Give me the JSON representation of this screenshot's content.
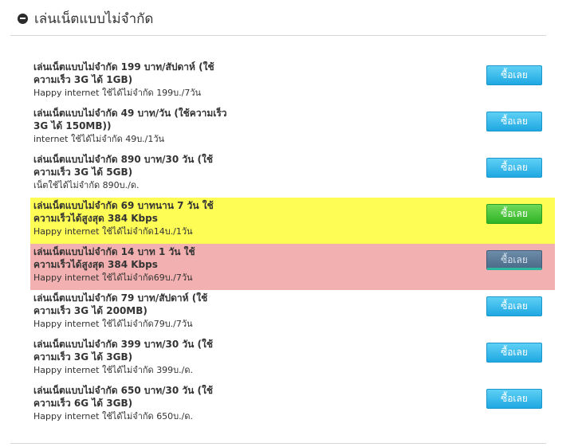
{
  "section": {
    "title": "เล่นเน็ตแบบไม่จำกัด"
  },
  "plans": [
    {
      "title_line1": "เล่นเน็ตแบบไม่จำกัด 199 บาท/สัปดาห์ (ใช้",
      "title_line2": "ความเร็ว 3G ได้ 1GB)",
      "description": "Happy internet ใช้ได้ไม่จำกัด 199บ./7วัน",
      "button_label": "ซื้อเลย",
      "highlight": "none"
    },
    {
      "title_line1": "เล่นเน็ตแบบไม่จำกัด 49 บาท/วัน (ใช้ความเร็ว",
      "title_line2": "3G ได้ 150MB))",
      "description": "internet ใช้ได้ไม่จำกัด 49บ./1วัน",
      "button_label": "ซื้อเลย",
      "highlight": "none"
    },
    {
      "title_line1": "เล่นเน็ตแบบไม่จำกัด 890 บาท/30 วัน (ใช้",
      "title_line2": "ความเร็ว 3G ได้ 5GB)",
      "description": "เน็ตใช้ได้ไม่จำกัด 890บ./ด.",
      "button_label": "ซื้อเลย",
      "highlight": "none"
    },
    {
      "title_line1": "เล่นเน็ตแบบไม่จำกัด 69 บาทนาน 7 วัน ใช้",
      "title_line2": "ความเร็วได้สูงสุด 384 Kbps",
      "description": "Happy internet ใช้ได้ไม่จำกัด14บ./1วัน",
      "button_label": "ซื้อเลย",
      "highlight": "yellow"
    },
    {
      "title_line1": "เล่นเน็ตแบบไม่จำกัด 14 บาท 1 วัน  ใช้",
      "title_line2": "ความเร็วได้สูงสุด 384 Kbps",
      "description": "Happy internet ใช้ได้ไม่จำกัด69บ./7วัน",
      "button_label": "ซื้อเลย",
      "highlight": "pink"
    },
    {
      "title_line1": "เล่นเน็ตแบบไม่จำกัด 79 บาท/สัปดาห์ (ใช้",
      "title_line2": "ความเร็ว 3G ได้ 200MB)",
      "description": "Happy internet ใช้ได้ไม่จำกัด79บ./7วัน",
      "button_label": "ซื้อเลย",
      "highlight": "none"
    },
    {
      "title_line1": "เล่นเน็ตแบบไม่จำกัด 399 บาท/30 วัน (ใช้",
      "title_line2": "ความเร็ว 3G ได้ 3GB)",
      "description": "Happy internet ใช้ได้ไม่จำกัด 399บ./ด.",
      "button_label": "ซื้อเลย",
      "highlight": "none"
    },
    {
      "title_line1": "เล่นเน็ตแบบไม่จำกัด 650 บาท/30 วัน (ใช้",
      "title_line2": "ความเร็ว 6G ได้ 3GB)",
      "description": "Happy internet ใช้ได้ไม่จำกัด 650บ./ด.",
      "button_label": "ซื้อเลย",
      "highlight": "none"
    }
  ],
  "colors": {
    "button_blue": "#2bb3ea",
    "button_green": "#3cbf2f",
    "button_steel": "#5a7a98",
    "highlight_yellow": "#fdfd56",
    "highlight_pink": "#f3b0b0"
  },
  "icons": {
    "collapse": "minus-circle-icon"
  }
}
